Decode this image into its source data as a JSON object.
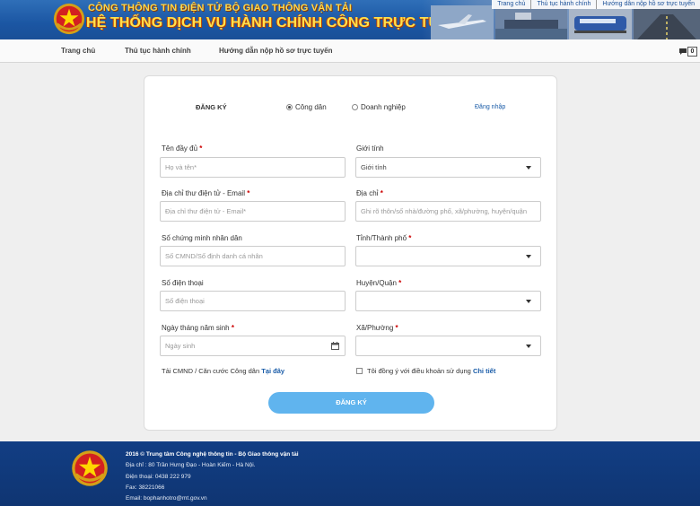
{
  "header": {
    "subtitle": "CÔNG THÔNG TIN ĐIỆN TỬ BỘ GIAO THÔNG VẬN TẢI",
    "title": "HỆ THỐNG DỊCH VỤ HÀNH CHÍNH CÔNG TRỰC TUYẾN",
    "top_links": [
      "Trang chủ",
      "Thủ tục hành chính",
      "Hướng dẫn nộp hồ sơ trực tuyến"
    ]
  },
  "nav": {
    "items": [
      "Trang chủ",
      "Thủ tục hành chính",
      "Hướng dẫn nộp hồ sơ trực tuyến"
    ],
    "message_count": "0"
  },
  "form": {
    "title": "ĐĂNG KÝ",
    "account_types": [
      {
        "label": "Công dân",
        "selected": true
      },
      {
        "label": "Doanh nghiệp",
        "selected": false
      }
    ],
    "login_link": "Đăng nhập",
    "fields": {
      "full_name": {
        "label": "Tên đầy đủ",
        "placeholder": "Họ và tên*"
      },
      "gender": {
        "label": "Giới tính",
        "value": "Giới tính"
      },
      "email": {
        "label": "Địa chỉ thư điện tử - Email",
        "placeholder": "Địa chỉ thư điện tử - Email*"
      },
      "address": {
        "label": "Địa chỉ",
        "placeholder": "Ghi rõ thôn/số nhà/đường phố, xã/phường, huyện/quận"
      },
      "id_number": {
        "label": "Số chứng minh nhân dân",
        "placeholder": "Số CMND/Số định danh cá nhân"
      },
      "province": {
        "label": "Tỉnh/Thành phố",
        "value": ""
      },
      "phone": {
        "label": "Số điện thoại",
        "placeholder": "Số điện thoại"
      },
      "district": {
        "label": "Huyện/Quận",
        "value": ""
      },
      "birthdate": {
        "label": "Ngày tháng năm sinh",
        "placeholder": "Ngày sinh"
      },
      "ward": {
        "label": "Xã/Phường",
        "value": ""
      }
    },
    "upload_text": "Tải CMND / Căn cước Công dân",
    "upload_link": "Tại đây",
    "agree_text": "Tôi đồng ý với điều khoản sử dụng",
    "agree_link": "Chi tiết",
    "submit_label": "ĐĂNG KÝ"
  },
  "footer": {
    "lines": [
      "2016 © Trung tâm Công nghệ thông tin - Bộ Giao thông vận tải",
      "Địa chỉ : 80 Trần Hưng Đạo - Hoàn Kiếm - Hà Nội.",
      "Điện thoại: 0438 222 979",
      "Fax: 38221066",
      "Email: bophanhotro@mt.gov.vn"
    ]
  },
  "colors": {
    "header_blue": "#1b56a3",
    "footer_blue": "#123e84",
    "submit_button": "#60b4ee",
    "link_blue": "#1a5ca8",
    "required_red": "#cc0000"
  }
}
